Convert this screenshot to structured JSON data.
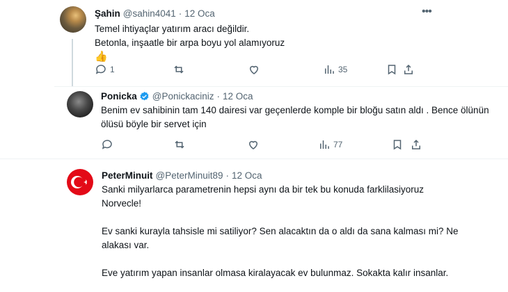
{
  "tweets": [
    {
      "name": "Şahin",
      "handle": "@sahin4041",
      "date": "12 Oca",
      "body": [
        "Temel ihtiyaçlar yatırım aracı değildir.",
        "Betonla, inşaatle bir arpa boyu yol alamıyoruz",
        "👍"
      ],
      "replies": "1",
      "views": "35"
    },
    {
      "name": "Ponicka",
      "handle": "@Ponickaciniz",
      "date": "12 Oca",
      "verified": true,
      "body": [
        "Benim ev sahibinin tam 140 dairesi var geçenlerde komple bir bloğu satın aldı . Bence ölünün ölüsü böyle bir servet için"
      ],
      "views": "77"
    },
    {
      "name": "PeterMinuit",
      "handle": "@PeterMinuit89",
      "date": "12 Oca",
      "body": [
        "Sanki milyarlarca  parametrenin hepsi aynı da bir tek bu konuda farklilasiyoruz Norvecle!",
        "Ev sanki kurayla tahsisle mi satiliyor?  Sen alacaktın da o aldı da sana kalması mi? Ne alakası var.",
        "Eve yatırım yapan insanlar olmasa kiralayacak ev bulunmaz. Sokakta kalır insanlar."
      ]
    }
  ],
  "separator": "·",
  "colors": {
    "text": "#0f1419",
    "muted": "#536471",
    "verified": "#1d9bf0",
    "flag": "#e30a17"
  }
}
